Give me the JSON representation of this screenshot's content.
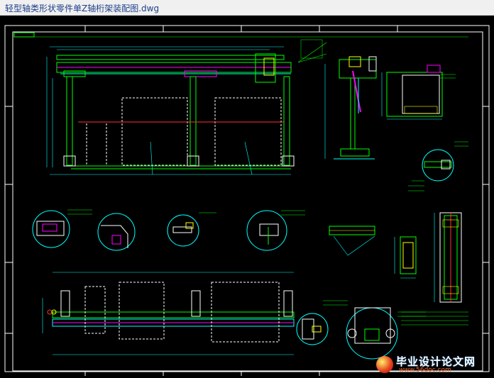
{
  "window": {
    "title": "轻型轴类形状零件单Z轴桁架装配图.dwg"
  },
  "watermark": {
    "title": "毕业设计论文网",
    "url": "www.56doc.com"
  },
  "colors": {
    "background": "#000000",
    "frame": "#ffffff",
    "structure": "#00ff00",
    "detail": "#00ffff",
    "hidden": "#ffffff",
    "accent_red": "#ff3030",
    "accent_magenta": "#ff00ff",
    "accent_yellow": "#ffff00"
  }
}
